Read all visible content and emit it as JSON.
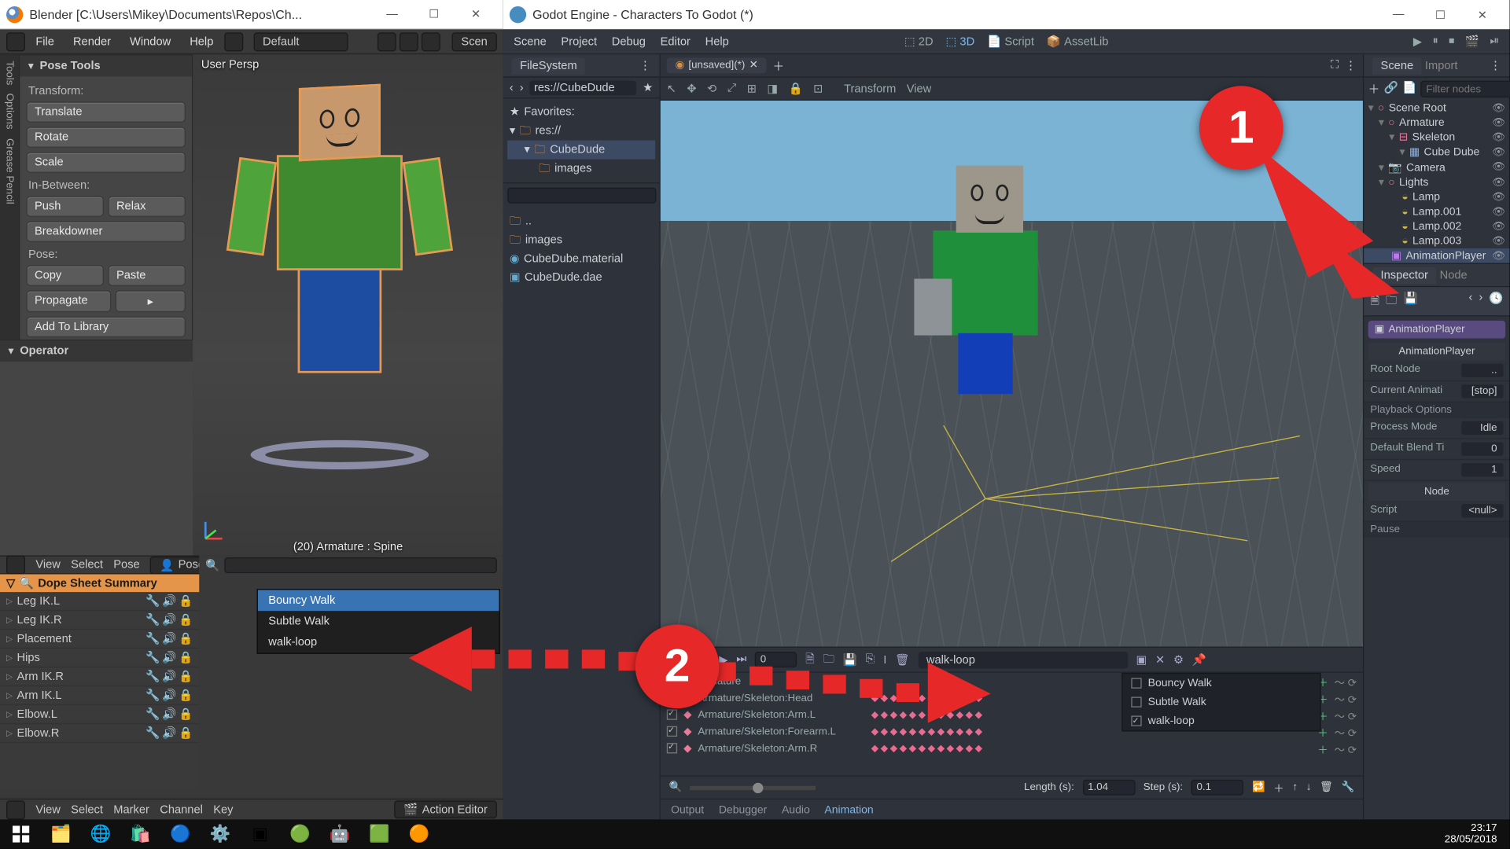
{
  "blender": {
    "title": "Blender  [C:\\Users\\Mikey\\Documents\\Repos\\Ch...",
    "menus": [
      "File",
      "Render",
      "Window",
      "Help"
    ],
    "layout": "Default",
    "side_tabs": [
      "Tools",
      "Options",
      "Grease Pencil"
    ],
    "posetools": {
      "title": "Pose Tools",
      "transform_label": "Transform:",
      "translate": "Translate",
      "rotate": "Rotate",
      "scale": "Scale",
      "inbetween_label": "In-Between:",
      "push": "Push",
      "relax": "Relax",
      "breakdowner": "Breakdowner",
      "pose_label": "Pose:",
      "copy": "Copy",
      "paste": "Paste",
      "propagate": "Propagate",
      "addlib": "Add To Library"
    },
    "operator": "Operator",
    "viewport_label": "User Persp",
    "viewport_footer": "(20) Armature : Spine",
    "dopesheet": {
      "bar": [
        "View",
        "Select",
        "Pose"
      ],
      "mode": "Pose Mo",
      "summary": "Dope Sheet Summary",
      "channels": [
        "Leg IK.L",
        "Leg IK.R",
        "Placement",
        "Hips",
        "Arm IK.R",
        "Arm IK.L",
        "Elbow.L",
        "Elbow.R"
      ]
    },
    "action_list": [
      "Bouncy Walk",
      "Subtle Walk",
      "walk-loop"
    ],
    "bottombar": [
      "View",
      "Select",
      "Marker",
      "Channel",
      "Key"
    ],
    "action_editor": "Action Editor"
  },
  "godot": {
    "title": "Godot Engine - Characters To Godot (*)",
    "menus": [
      "Scene",
      "Project",
      "Debug",
      "Editor",
      "Help"
    ],
    "workspace": {
      "2d": "2D",
      "3d": "3D",
      "script": "Script",
      "assetlib": "AssetLib"
    },
    "fs": {
      "title": "FileSystem",
      "path": "res://CubeDude",
      "favorites": "Favorites:",
      "tree": [
        "res://",
        "CubeDude",
        "images"
      ],
      "thumbs": [
        "images",
        "CubeDube.material",
        "CubeDude.dae"
      ]
    },
    "tabs": {
      "name": "[unsaved](*)"
    },
    "viewbar": [
      "Transform",
      "View"
    ],
    "scene": {
      "tab_scene": "Scene",
      "tab_import": "Import",
      "filter": "Filter nodes",
      "nodes": [
        {
          "name": "Scene Root",
          "type": "3d"
        },
        {
          "name": "Armature",
          "type": "3d"
        },
        {
          "name": "Skeleton",
          "type": "sk"
        },
        {
          "name": "Cube Dube",
          "type": "mesh"
        },
        {
          "name": "Camera",
          "type": "cam"
        },
        {
          "name": "Lights",
          "type": "3d"
        },
        {
          "name": "Lamp",
          "type": "lt"
        },
        {
          "name": "Lamp.001",
          "type": "lt"
        },
        {
          "name": "Lamp.002",
          "type": "lt"
        },
        {
          "name": "Lamp.003",
          "type": "lt"
        },
        {
          "name": "AnimationPlayer",
          "type": "anim",
          "sel": true
        }
      ]
    },
    "inspector": {
      "tab_inspector": "Inspector",
      "tab_node": "Node",
      "path": "AnimationPlayer",
      "class": "AnimationPlayer",
      "rootnode_k": "Root Node",
      "rootnode_v": "..",
      "curanim_k": "Current Animati",
      "curanim_v": "[stop]",
      "playback": "Playback Options",
      "pmode_k": "Process Mode",
      "pmode_v": "Idle",
      "blend_k": "Default Blend Ti",
      "blend_v": "0",
      "speed_k": "Speed",
      "speed_v": "1",
      "node": "Node",
      "script_k": "Script",
      "script_v": "<null>",
      "pause": "Pause"
    },
    "anim": {
      "current": "walk-loop",
      "list": [
        "Bouncy Walk",
        "Subtle Walk",
        "walk-loop"
      ],
      "tracks": [
        "Armature",
        "Armature/Skeleton:Head",
        "Armature/Skeleton:Arm.L",
        "Armature/Skeleton:Forearm.L",
        "Armature/Skeleton:Arm.R"
      ],
      "length_k": "Length (s):",
      "length_v": "1.04",
      "step_k": "Step (s):",
      "step_v": "0.1",
      "bottom": [
        "Output",
        "Debugger",
        "Audio",
        "Animation"
      ]
    }
  },
  "annotation": {
    "one": "1",
    "two": "2"
  },
  "taskbar": {
    "time": "23:17",
    "date": "28/05/2018"
  }
}
